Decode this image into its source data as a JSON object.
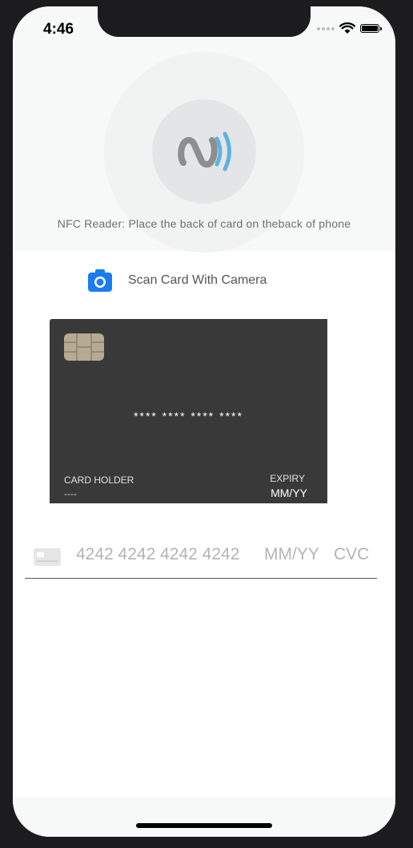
{
  "status_bar": {
    "time": "4:46",
    "icons": [
      "signal-dots-icon",
      "wifi-icon",
      "battery-icon"
    ]
  },
  "nfc": {
    "icon": "nfc-icon",
    "caption": "NFC Reader: Place the back of card on theback of phone",
    "colors": {
      "icon_gray": "#8e8e8e",
      "wave_blue": "#5fb2e0"
    }
  },
  "scan": {
    "icon": "camera-icon",
    "label": "Scan Card With Camera",
    "icon_color": "#1a7cf0"
  },
  "card": {
    "number": "**** **** **** ****",
    "holder_label": "CARD HOLDER",
    "holder_value": "----",
    "expiry_label": "EXPIRY",
    "expiry_value": "MM/YY",
    "background": "#3a3939"
  },
  "input": {
    "card_icon": "credit-card-icon",
    "number_placeholder": "4242 4242 4242 4242",
    "expiry_placeholder": "MM/YY",
    "cvc_placeholder": "CVC"
  }
}
